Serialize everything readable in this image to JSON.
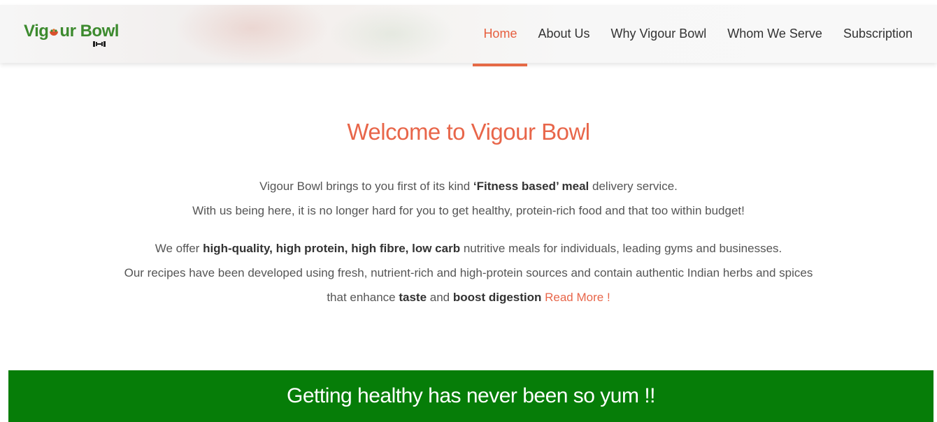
{
  "header": {
    "logo": {
      "text_before": "Vig",
      "text_middle": "ur Bo",
      "text_after": "l",
      "w_letter": "w",
      "brand_color": "#3c8a2e"
    },
    "nav": [
      {
        "label": "Home",
        "active": true
      },
      {
        "label": "About Us",
        "active": false
      },
      {
        "label": "Why Vigour Bowl",
        "active": false
      },
      {
        "label": "Whom We Serve",
        "active": false
      },
      {
        "label": "Subscription",
        "active": false
      }
    ],
    "accent_color": "#e65f3f"
  },
  "welcome": {
    "title": "Welcome to Vigour Bowl",
    "para1": {
      "line1_start": "Vigour Bowl brings to you first of its kind ",
      "line1_bold": "‘Fitness based’ meal",
      "line1_end": " delivery service.",
      "line2": "With us being here, it is no longer hard for you to get healthy, protein-rich food and that too within budget!"
    },
    "para2": {
      "line1_start": "We offer ",
      "line1_bold": "high-quality, high protein, high fibre, low carb",
      "line1_end": " nutritive meals for individuals, leading gyms and businesses.",
      "line2": "Our recipes have been developed using fresh, nutrient-rich and high-protein sources and contain authentic Indian herbs and spices",
      "line3_start": "that enhance ",
      "line3_bold1": "taste",
      "line3_mid": " and ",
      "line3_bold2": "boost digestion",
      "line3_space": " ",
      "read_more": "Read More !"
    }
  },
  "banner": {
    "text": "Getting healthy has never been so yum !!",
    "color": "#067d08"
  }
}
